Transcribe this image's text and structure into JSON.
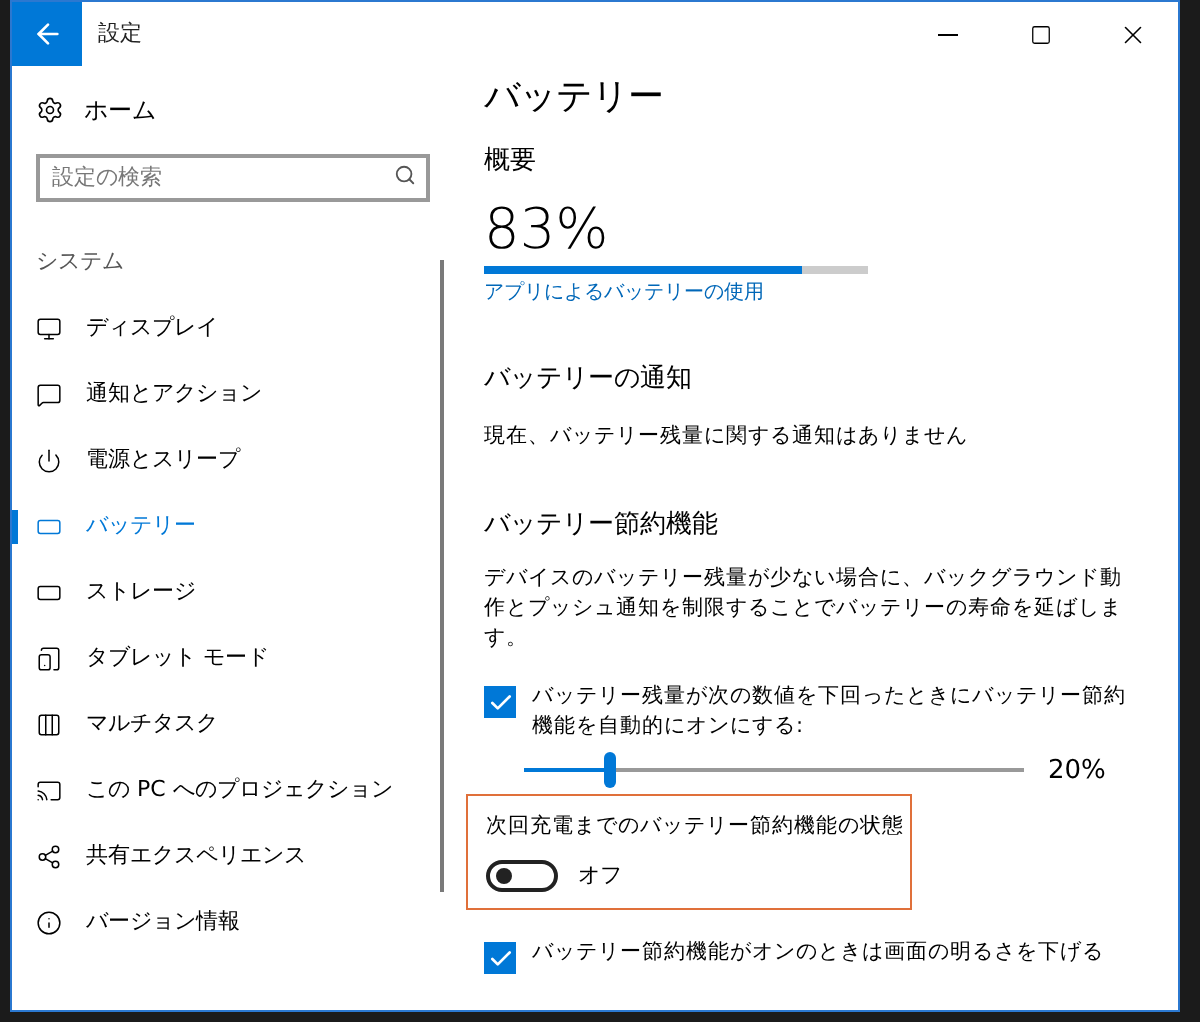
{
  "window": {
    "title": "設定"
  },
  "sidebar": {
    "home": "ホーム",
    "search": {
      "placeholder": "設定の検索"
    },
    "section": "システム",
    "items": [
      {
        "label": "ディスプレイ",
        "selected": false
      },
      {
        "label": "通知とアクション",
        "selected": false
      },
      {
        "label": "電源とスリープ",
        "selected": false
      },
      {
        "label": "バッテリー",
        "selected": true
      },
      {
        "label": "ストレージ",
        "selected": false
      },
      {
        "label": "タブレット モード",
        "selected": false
      },
      {
        "label": "マルチタスク",
        "selected": false
      },
      {
        "label": "この PC へのプロジェクション",
        "selected": false
      },
      {
        "label": "共有エクスペリエンス",
        "selected": false
      },
      {
        "label": "バージョン情報",
        "selected": false
      }
    ]
  },
  "main": {
    "title": "バッテリー",
    "overview": {
      "heading": "概要",
      "percent": "83%",
      "level": 0.83,
      "link": "アプリによるバッテリーの使用"
    },
    "notifications": {
      "heading": "バッテリーの通知",
      "text": "現在、バッテリー残量に関する通知はありません"
    },
    "saver": {
      "heading": "バッテリー節約機能",
      "description": "デバイスのバッテリー残量が少ない場合に、バックグラウンド動作とプッシュ通知を制限することでバッテリーの寿命を延ばします。",
      "auto": {
        "label": "バッテリー残量が次の数値を下回ったときにバッテリー節約機能を自動的にオンにする:",
        "checked": true
      },
      "slider": {
        "level": 0.17,
        "reading": "20%"
      },
      "status": {
        "label": "次回充電までのバッテリー節約機能の状態",
        "on": false,
        "state": "オフ"
      },
      "brightness": {
        "label": "バッテリー節約機能がオンのときは画面の明るさを下げる",
        "checked": true
      }
    }
  }
}
